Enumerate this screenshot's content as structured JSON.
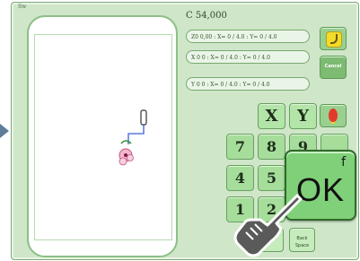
{
  "screen": {
    "corner_label": "Sw",
    "status": "C 54,000",
    "coordinates": [
      "Z0 0,00 : X= 0 / 4.0 :  Y= 0 / 4.0",
      "X 0 0 : X= 0 / 4.0 :  Y= 0 / 4.0",
      "Y 0 0 : X= 0 / 4.0 :  Y= 0 / 4.0"
    ]
  },
  "side_buttons": {
    "cancel_label": "Cancel"
  },
  "keypad": {
    "axis_keys": [
      "X",
      "Y"
    ],
    "digits": [
      "7",
      "8",
      "9",
      "4",
      "5",
      "1",
      "2"
    ],
    "function_keys": [
      "Back",
      "Back Space"
    ]
  },
  "ok_button": {
    "label": "OK",
    "fkey": "f"
  },
  "colors": {
    "panel": "#cfe6c8",
    "key": "#a6dd9b",
    "ok": "#7fd078",
    "accent_blue": "#3a5fd8",
    "hand": "#5a5a5a"
  }
}
